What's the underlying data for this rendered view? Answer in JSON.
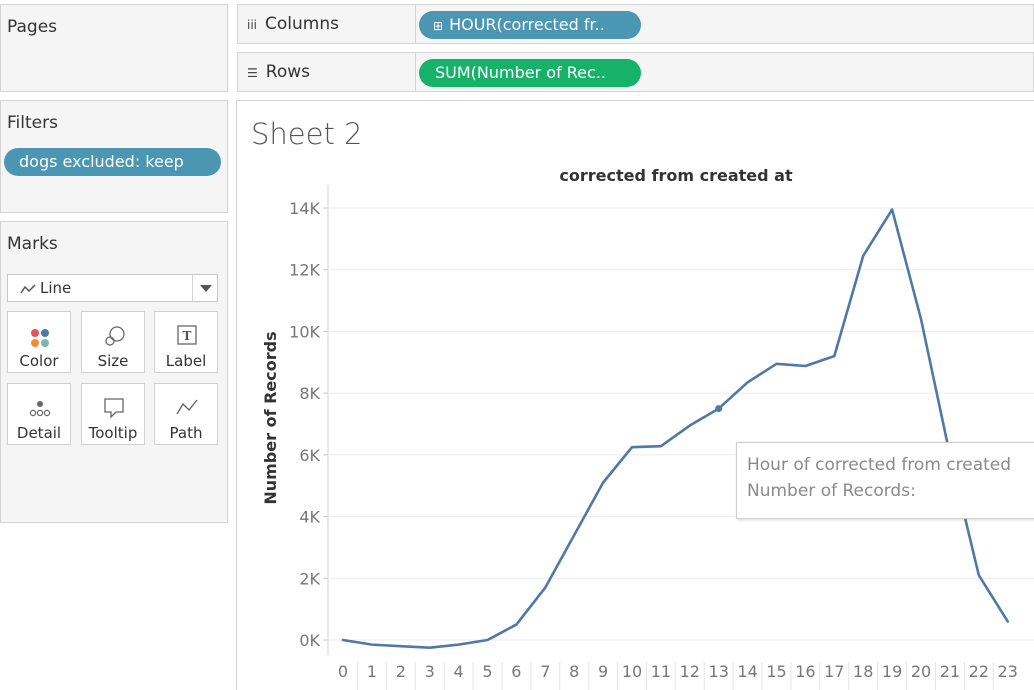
{
  "pages_panel": {
    "title": "Pages"
  },
  "filters_panel": {
    "title": "Filters",
    "pill": "dogs excluded: keep"
  },
  "marks_panel": {
    "title": "Marks",
    "type_select": "Line",
    "buttons": [
      {
        "label": "Color",
        "icon": "color-dots-icon"
      },
      {
        "label": "Size",
        "icon": "size-circles-icon"
      },
      {
        "label": "Label",
        "icon": "label-t-icon"
      },
      {
        "label": "Detail",
        "icon": "detail-dots-icon"
      },
      {
        "label": "Tooltip",
        "icon": "tooltip-bubble-icon"
      },
      {
        "label": "Path",
        "icon": "path-line-icon"
      }
    ]
  },
  "shelves": {
    "columns_label": "Columns",
    "columns_pill": "HOUR(corrected fr..",
    "rows_label": "Rows",
    "rows_pill": "SUM(Number of Rec.."
  },
  "sheet": {
    "title": "Sheet 2"
  },
  "tooltip": {
    "line1": "Hour of corrected from created",
    "line2": "Number of Records:"
  },
  "chart_data": {
    "type": "line",
    "title": "corrected from created at",
    "xlabel": "",
    "ylabel": "Number of Records",
    "x": [
      0,
      1,
      2,
      3,
      4,
      5,
      6,
      7,
      8,
      9,
      10,
      11,
      12,
      13,
      14,
      15,
      16,
      17,
      18,
      19,
      20,
      21,
      22,
      23
    ],
    "y_tick_labels": [
      "0K",
      "2K",
      "4K",
      "6K",
      "8K",
      "10K",
      "12K",
      "14K"
    ],
    "ylim": [
      0,
      14000
    ],
    "series": [
      {
        "values": [
          0,
          -150,
          -200,
          -250,
          -150,
          0,
          500,
          1700,
          3400,
          5100,
          6250,
          6280,
          6950,
          7500,
          8350,
          8950,
          8880,
          9200,
          12450,
          13950,
          10400,
          6000,
          2100,
          600
        ]
      }
    ],
    "line_color": "#4e79a7",
    "grid": "horizontal",
    "highlighted_point_x": 13
  }
}
